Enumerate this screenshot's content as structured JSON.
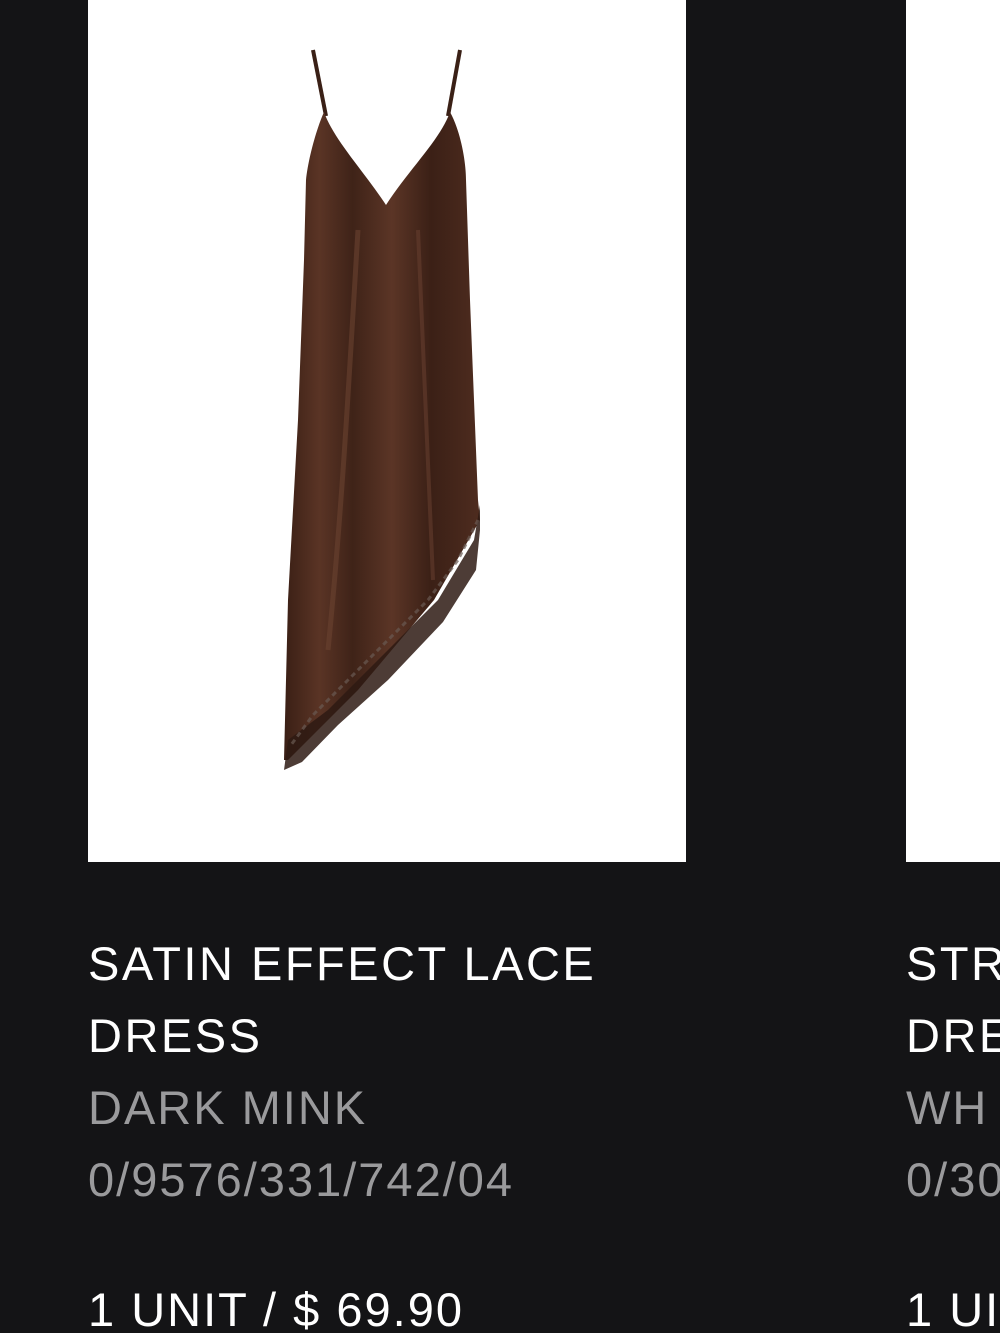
{
  "products": [
    {
      "title_line1": "SATIN EFFECT LACE",
      "title_line2": "DRESS",
      "color": "DARK MINK",
      "reference": "0/9576/331/742/04",
      "price_line": "1 UNIT / $ 69.90",
      "image_icon": "brown-satin-slip-dress-image"
    },
    {
      "title_line1": "STR",
      "title_line2": "DRE",
      "color": "WH",
      "reference": "0/30",
      "price_line": "1 UI"
    }
  ],
  "colors": {
    "background": "#141416",
    "text_primary": "#ffffff",
    "text_secondary": "#9a9a9c",
    "dress": "#4a2a1d"
  }
}
